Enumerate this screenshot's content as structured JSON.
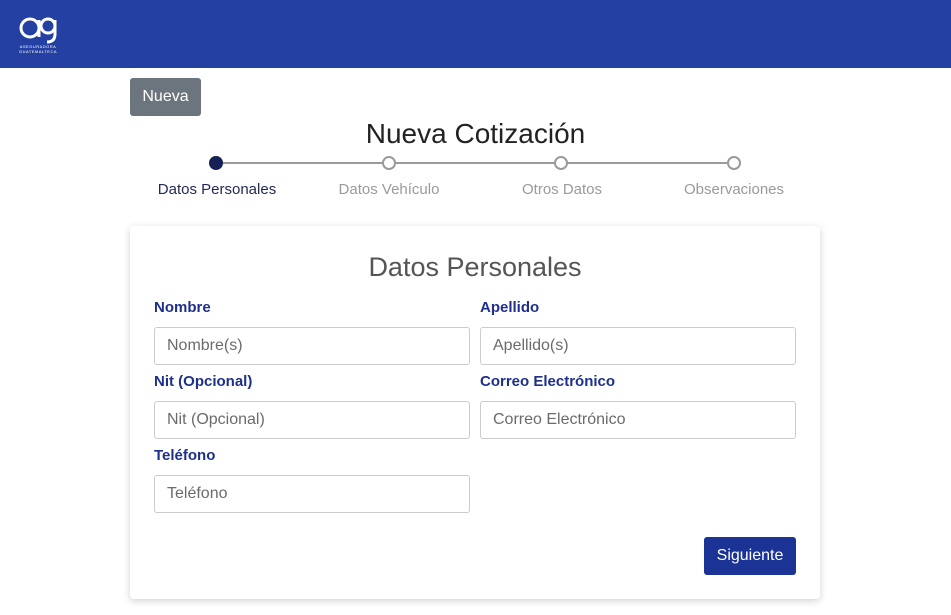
{
  "header": {
    "logo_text": "ASEGURADORA GUATEMALTECA",
    "brand_color": "#2540a3"
  },
  "toolbar": {
    "new_label": "Nueva"
  },
  "page": {
    "title": "Nueva Cotización"
  },
  "steps": [
    {
      "label": "Datos Personales",
      "active": true
    },
    {
      "label": "Datos Vehículo",
      "active": false
    },
    {
      "label": "Otros Datos",
      "active": false
    },
    {
      "label": "Observaciones",
      "active": false
    }
  ],
  "form": {
    "title": "Datos Personales",
    "fields": {
      "nombre": {
        "label": "Nombre",
        "placeholder": "Nombre(s)",
        "value": ""
      },
      "apellido": {
        "label": "Apellido",
        "placeholder": "Apellido(s)",
        "value": ""
      },
      "nit": {
        "label": "Nit (Opcional)",
        "placeholder": "Nit (Opcional)",
        "value": ""
      },
      "correo": {
        "label": "Correo Electrónico",
        "placeholder": "Correo Electrónico",
        "value": ""
      },
      "telefono": {
        "label": "Teléfono",
        "placeholder": "Teléfono",
        "value": ""
      }
    },
    "next_label": "Siguiente"
  }
}
